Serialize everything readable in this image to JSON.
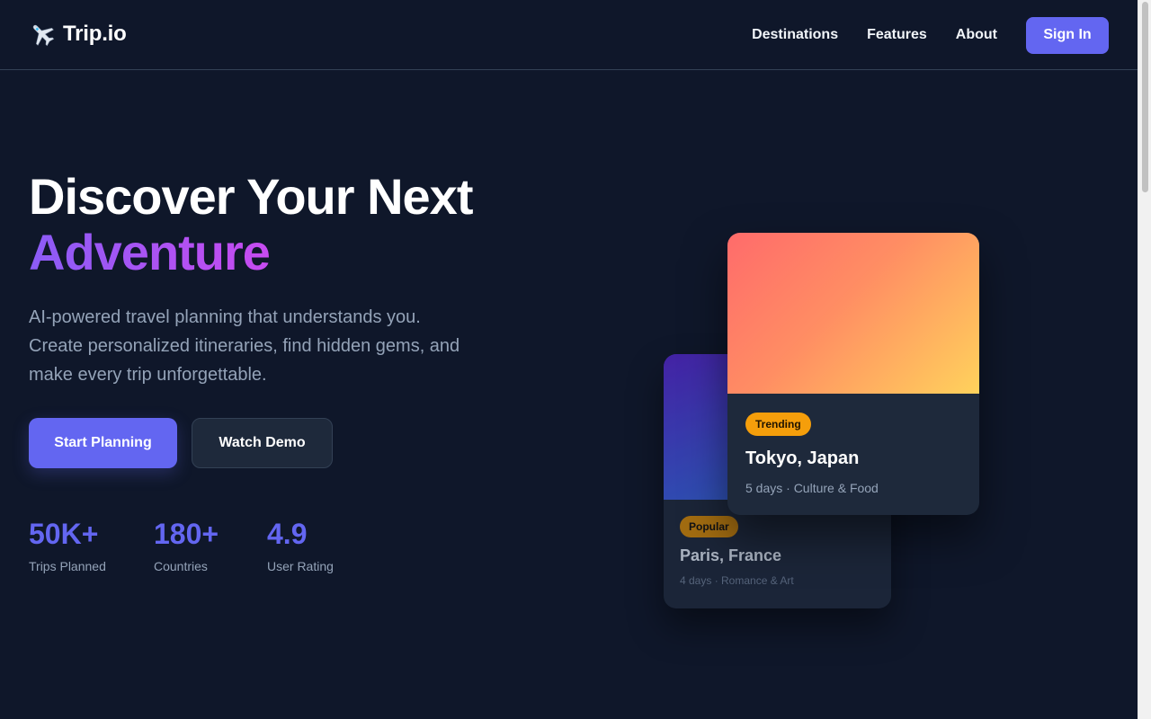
{
  "brand": {
    "name": "Trip.io",
    "icon": "airplane-icon"
  },
  "nav": {
    "links": [
      "Destinations",
      "Features",
      "About"
    ],
    "sign_in": "Sign In"
  },
  "hero": {
    "title_line1": "Discover Your Next",
    "title_line2": "Adventure",
    "subtitle": "AI-powered travel planning that understands you. Create personalized itineraries, find hidden gems, and make every trip unforgettable.",
    "primary_cta": "Start Planning",
    "secondary_cta": "Watch Demo"
  },
  "stats": [
    {
      "value": "50K+",
      "label": "Trips Planned"
    },
    {
      "value": "180+",
      "label": "Countries"
    },
    {
      "value": "4.9",
      "label": "User Rating"
    }
  ],
  "cards": [
    {
      "badge": "Trending",
      "title": "Tokyo, Japan",
      "meta": "5 days · Culture & Food"
    },
    {
      "badge": "Popular",
      "title": "Paris, France",
      "meta": "4 days · Romance & Art"
    }
  ],
  "colors": {
    "background": "#0f172a",
    "accent": "#6366f1",
    "badge": "#f59e0b",
    "gradient_text": [
      "#8b5cf6",
      "#ec4899"
    ]
  }
}
